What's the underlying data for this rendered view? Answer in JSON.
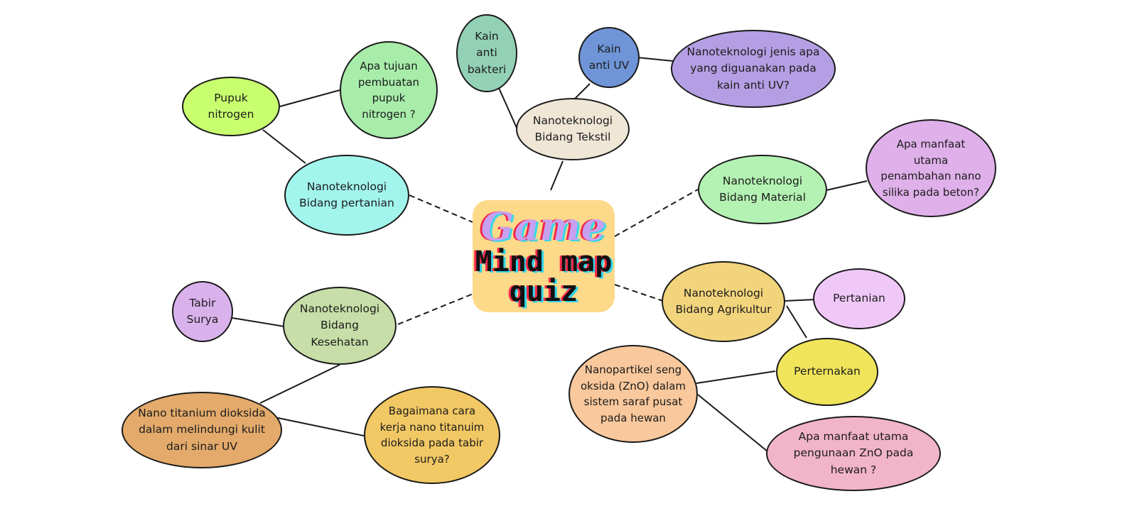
{
  "center": {
    "line1": "Game",
    "line2": "Mind map\nquiz",
    "bg_color": "#fdd98a"
  },
  "nodes": {
    "pupuk": {
      "label": "Pupuk\nnitrogen",
      "color": "#c8ff6e"
    },
    "tujuan_pupuk": {
      "label": "Apa tujuan\npembuatan\npupuk\nnitrogen ?",
      "color": "#a8ecaa"
    },
    "bidang_pertanian": {
      "label": "Nanoteknologi\nBidang pertanian",
      "color": "#a2f5ec"
    },
    "kain_bakteri": {
      "label": "Kain\nanti\nbakteri",
      "color": "#93d1b6"
    },
    "kain_uv": {
      "label": "Kain\nanti UV",
      "color": "#6f95d8"
    },
    "jenis_uv": {
      "label": "Nanoteknologi jenis apa\nyang diguanakan pada\nkain anti UV?",
      "color": "#b59fe4"
    },
    "bidang_tekstil": {
      "label": "Nanoteknologi\nBidang Tekstil",
      "color": "#efe6d6"
    },
    "bidang_material": {
      "label": "Nanoteknologi\nBidang Material",
      "color": "#b4f2b4"
    },
    "silika": {
      "label": "Apa manfaat\nutama\npenambahan nano\nsilika pada beton?",
      "color": "#dfb0ea"
    },
    "tabir": {
      "label": "Tabir\nSurya",
      "color": "#d9b2ec"
    },
    "bidang_kesehatan": {
      "label": "Nanoteknologi\nBidang\nKesehatan",
      "color": "#c7dea8"
    },
    "titanium": {
      "label": "Nano titanium dioksida\ndalam melindungi kulit\ndari sinar UV",
      "color": "#e3aa6b"
    },
    "cara_kerja": {
      "label": "Bagaimana cara\nkerja nano titanuim\ndioksida pada tabir\nsurya?",
      "color": "#f2c864"
    },
    "bidang_agrikultur": {
      "label": "Nanoteknologi\nBidang Agrikultur",
      "color": "#f2d47c"
    },
    "pertanian": {
      "label": "Pertanian",
      "color": "#f0c8f8"
    },
    "peternakan": {
      "label": "Perternakan",
      "color": "#f0e45a"
    },
    "zno": {
      "label": "Nanopartikel seng\noksida (ZnO) dalam\nsistem saraf pusat\npada hewan",
      "color": "#f9c89c"
    },
    "manfaat_zno": {
      "label": "Apa manfaat utama\npengunaan ZnO pada\nhewan ?",
      "color": "#f2b4c8"
    }
  }
}
